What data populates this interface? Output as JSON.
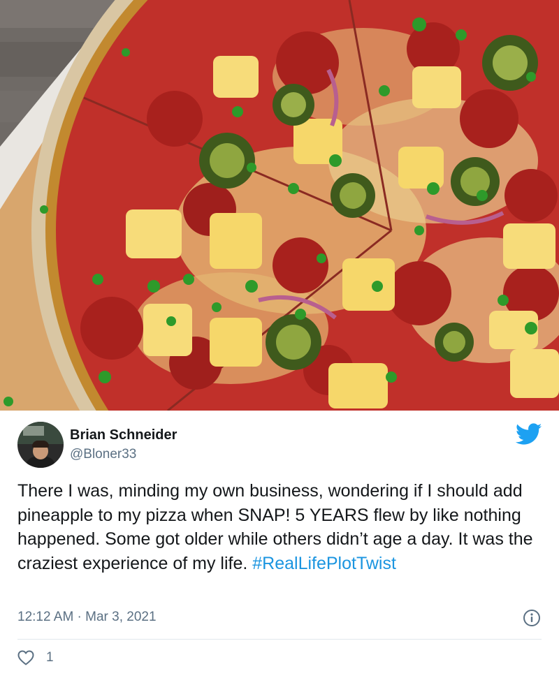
{
  "tweet": {
    "display_name": "Brian Schneider",
    "handle": "@Bloner33",
    "text_main": "There I was, minding my own business, wondering if I should add pineapple to my pizza when SNAP! 5 YEARS flew by like nothing happened. Some got older while others didn’t age a day. It was the craziest experience of my life. ",
    "hashtag": "#RealLifePlotTwist",
    "timestamp": "12:12 AM · Mar 3, 2021",
    "likes": "1"
  },
  "icons": {
    "logo": "twitter-bird-icon",
    "info": "info-icon",
    "like": "heart-icon"
  },
  "colors": {
    "accent": "#1da1f2",
    "hashtag": "#1b95e0",
    "secondary_text": "#5b7083",
    "primary_text": "#14171a"
  }
}
